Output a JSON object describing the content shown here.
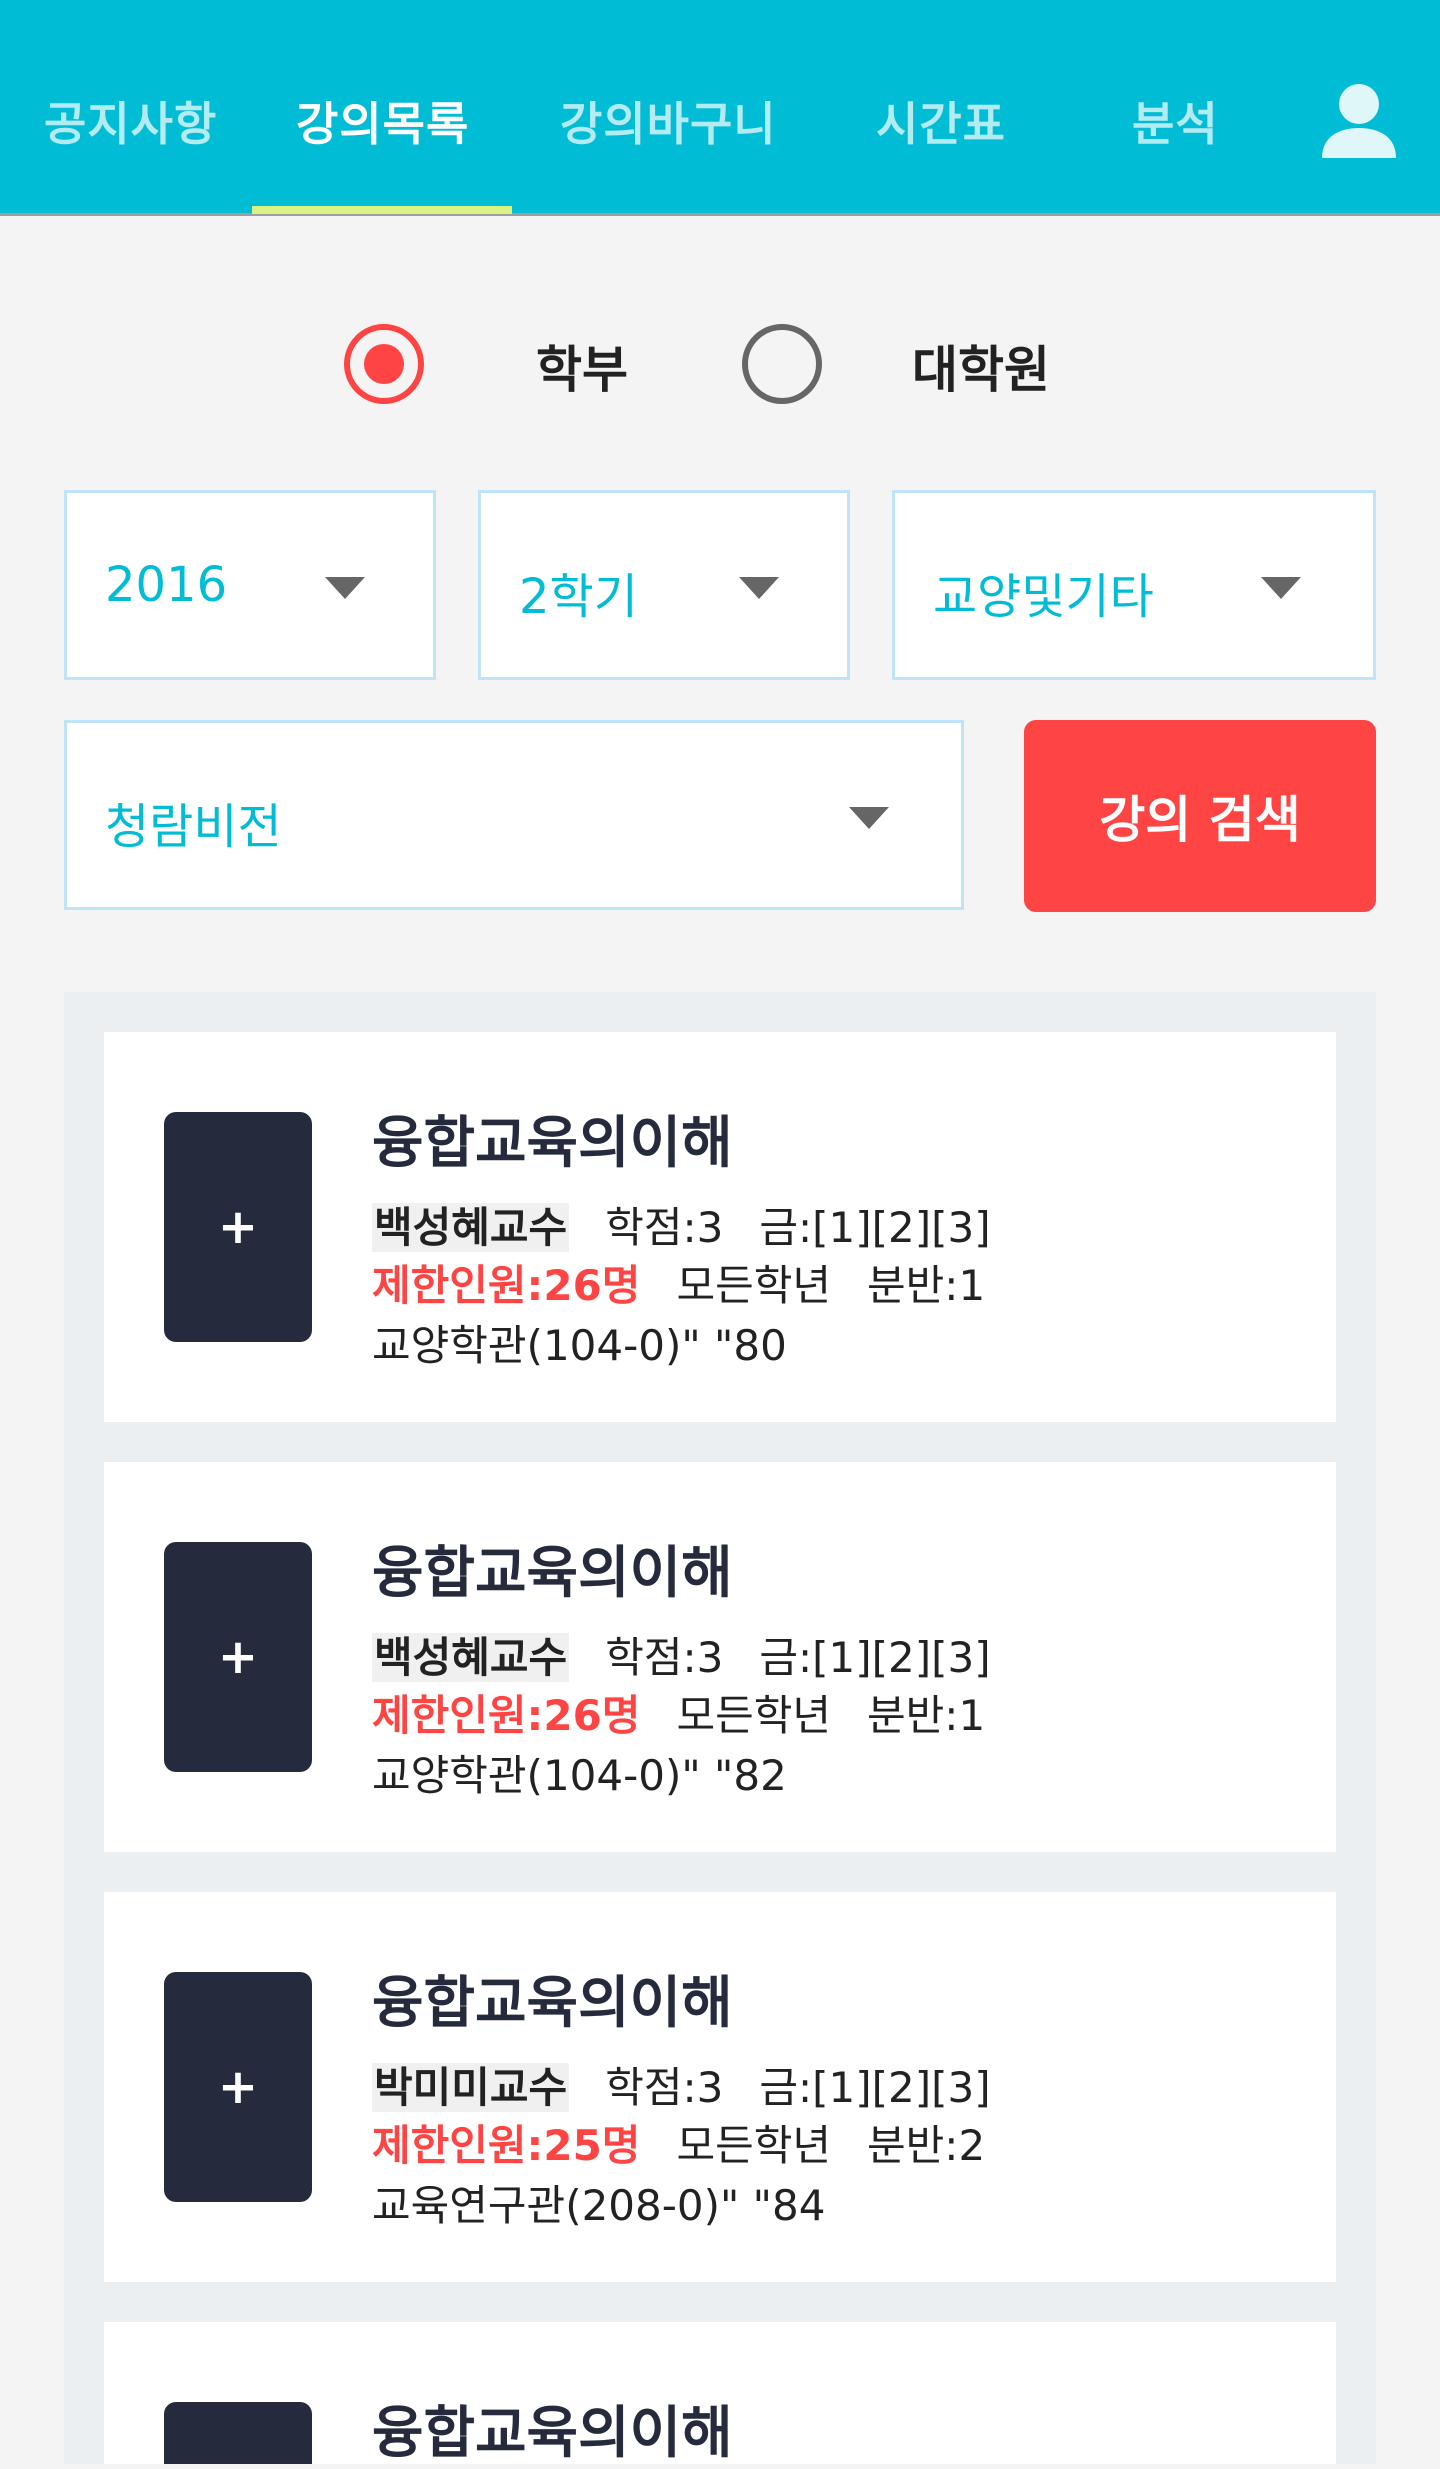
{
  "nav": {
    "tabs": [
      {
        "label": "공지사항"
      },
      {
        "label": "강의목록"
      },
      {
        "label": "강의바구니"
      },
      {
        "label": "시간표"
      },
      {
        "label": "분석"
      }
    ],
    "active_tab": "강의목록",
    "user_icon": "user-icon",
    "accent_color": "#00bcd4",
    "underline_color": "#dcf383"
  },
  "degree": {
    "options": [
      {
        "label": "학부",
        "checked": true
      },
      {
        "label": "대학원",
        "checked": false
      }
    ]
  },
  "filters": {
    "year": "2016",
    "semester": "2학기",
    "category": "교양및기타",
    "area": "청람비전"
  },
  "search_button": {
    "label": "강의 검색",
    "color": "#ff4444"
  },
  "courses": [
    {
      "add_label": "+",
      "title": "융합교육의이해",
      "professor": "백성혜교수",
      "credits": "학점:3",
      "schedule": "금:[1][2][3]",
      "limit": "제한인원:26명",
      "grade": "모든학년",
      "section": "분반:1",
      "location": "교양학관(104-0)\" \"80"
    },
    {
      "add_label": "+",
      "title": "융합교육의이해",
      "professor": "백성혜교수",
      "credits": "학점:3",
      "schedule": "금:[1][2][3]",
      "limit": "제한인원:26명",
      "grade": "모든학년",
      "section": "분반:1",
      "location": "교양학관(104-0)\" \"82"
    },
    {
      "add_label": "+",
      "title": "융합교육의이해",
      "professor": "박미미교수",
      "credits": "학점:3",
      "schedule": "금:[1][2][3]",
      "limit": "제한인원:25명",
      "grade": "모든학년",
      "section": "분반:2",
      "location": "교육연구관(208-0)\" \"84"
    },
    {
      "add_label": "",
      "title": "융합교육의이해"
    }
  ]
}
